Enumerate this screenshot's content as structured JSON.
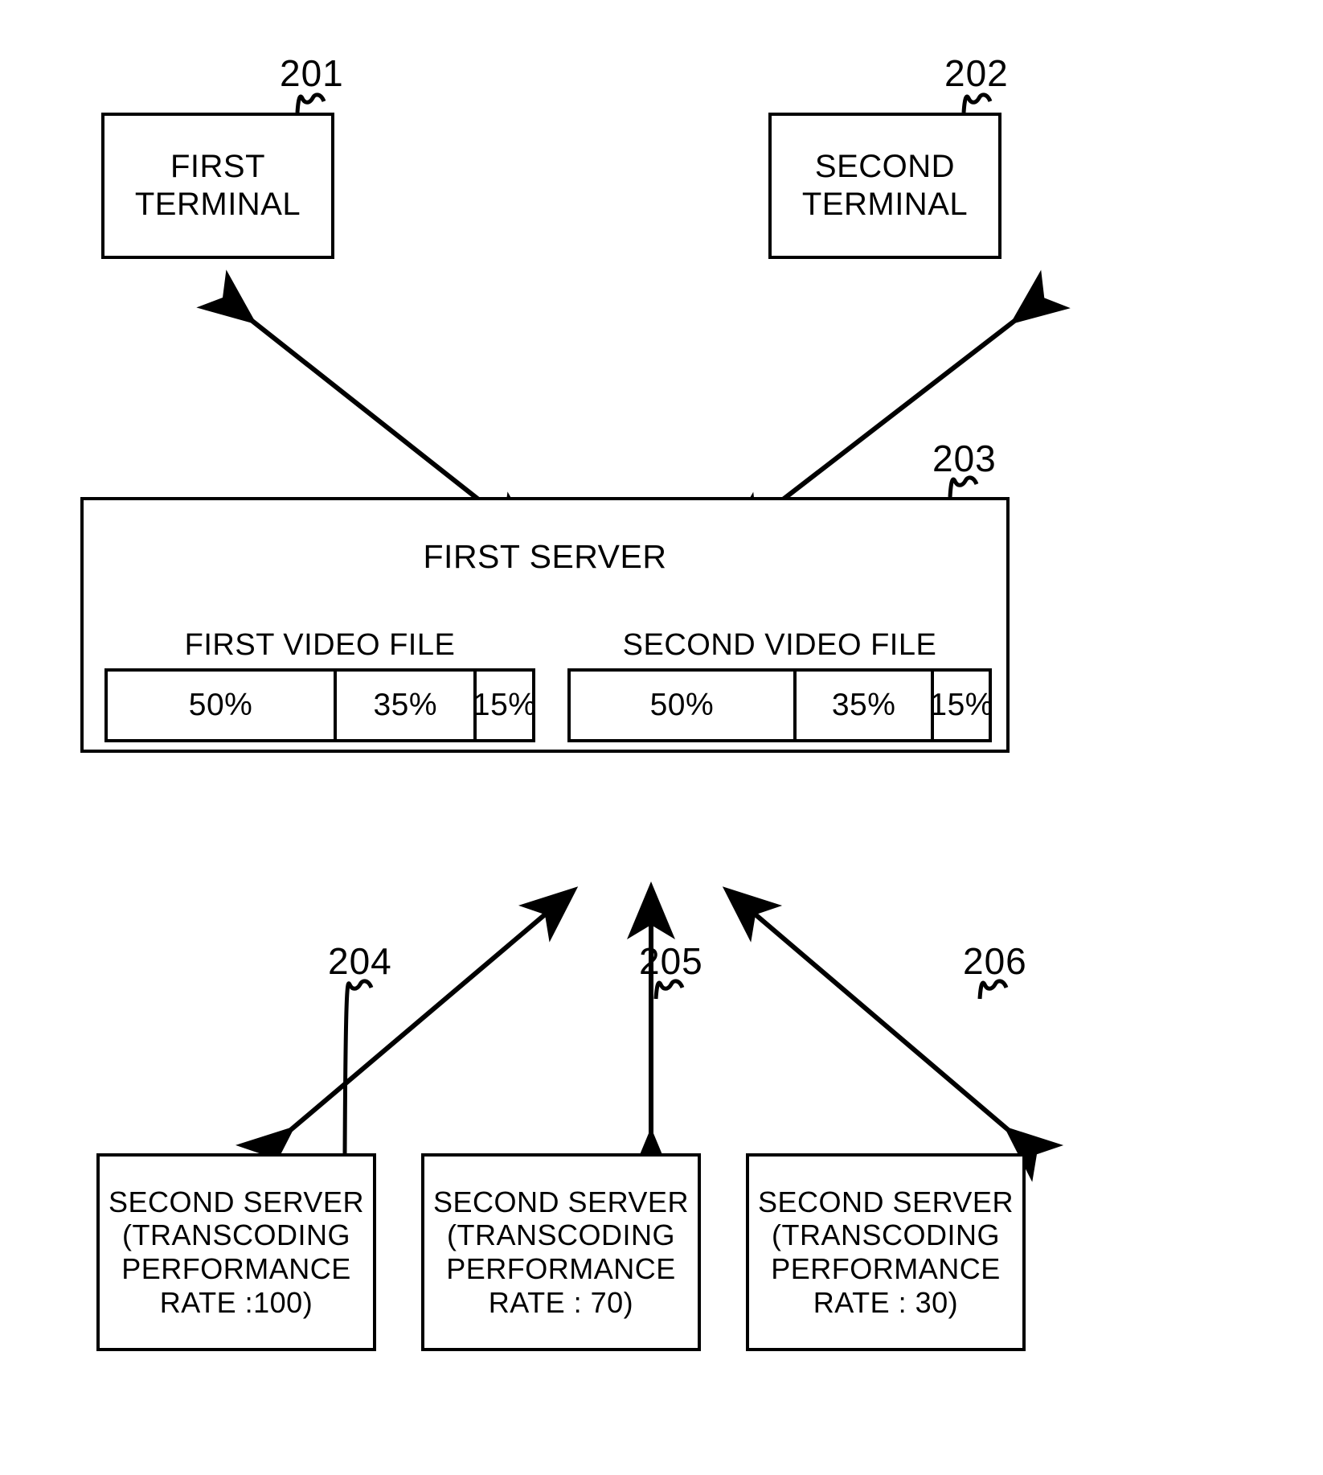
{
  "figure": {
    "type": "patent-block-diagram",
    "background_color": "#ffffff",
    "stroke_color": "#000000"
  },
  "nodes": {
    "terminal_first": {
      "ref": "201",
      "lines": [
        "FIRST",
        "TERMINAL"
      ]
    },
    "terminal_second": {
      "ref": "202",
      "lines": [
        "SECOND",
        "TERMINAL"
      ]
    },
    "server_first": {
      "ref": "203",
      "title": "FIRST SERVER",
      "video_files": [
        {
          "label": "FIRST VIDEO FILE",
          "segments": [
            "50%",
            "35%",
            "15%"
          ]
        },
        {
          "label": "SECOND VIDEO FILE",
          "segments": [
            "50%",
            "35%",
            "15%"
          ]
        }
      ]
    },
    "servers_second": [
      {
        "ref": "204",
        "lines": [
          "SECOND SERVER",
          "(TRANSCODING",
          "PERFORMANCE",
          "RATE :100)"
        ]
      },
      {
        "ref": "205",
        "lines": [
          "SECOND SERVER",
          "(TRANSCODING",
          "PERFORMANCE",
          "RATE : 70)"
        ]
      },
      {
        "ref": "206",
        "lines": [
          "SECOND SERVER",
          "(TRANSCODING",
          "PERFORMANCE",
          "RATE : 30)"
        ]
      }
    ]
  },
  "connectors": [
    {
      "name": "first-terminal-to-first-server",
      "style": "double-headed-arrow"
    },
    {
      "name": "second-terminal-to-first-server",
      "style": "double-headed-arrow"
    },
    {
      "name": "first-server-to-second-server-204",
      "style": "double-headed-arrow"
    },
    {
      "name": "first-server-to-second-server-205",
      "style": "double-headed-arrow"
    },
    {
      "name": "first-server-to-second-server-206",
      "style": "double-headed-arrow"
    }
  ]
}
